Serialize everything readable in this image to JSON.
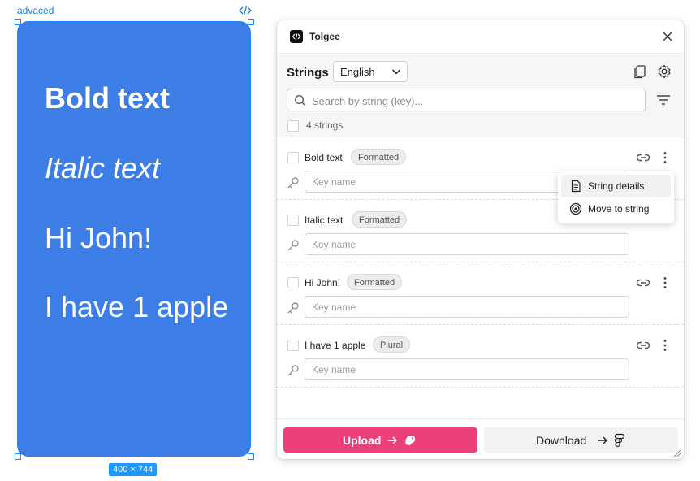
{
  "canvas": {
    "frame_label": "advaced",
    "frame_size": "400 × 744",
    "frame_color": "#3c7ee6",
    "texts": [
      "Bold text",
      "Italic text",
      "Hi John!",
      "I have 1 apple"
    ]
  },
  "plugin": {
    "title": "Tolgee",
    "strings_title": "Strings",
    "language": "English",
    "search_placeholder": "Search by string (key)...",
    "count_text": "4 strings",
    "key_placeholder": "Key name",
    "rows": [
      {
        "name": "Bold text",
        "tag": "Formatted"
      },
      {
        "name": "Italic text",
        "tag": "Formatted"
      },
      {
        "name": "Hi John!",
        "tag": "Formatted"
      },
      {
        "name": "I have 1 apple",
        "tag": "Plural"
      }
    ],
    "context_menu": {
      "items": [
        {
          "label": "String details",
          "icon": "document-icon"
        },
        {
          "label": "Move to string",
          "icon": "target-icon"
        }
      ]
    },
    "upload_label": "Upload",
    "download_label": "Download",
    "upload_color": "#ec407a"
  }
}
